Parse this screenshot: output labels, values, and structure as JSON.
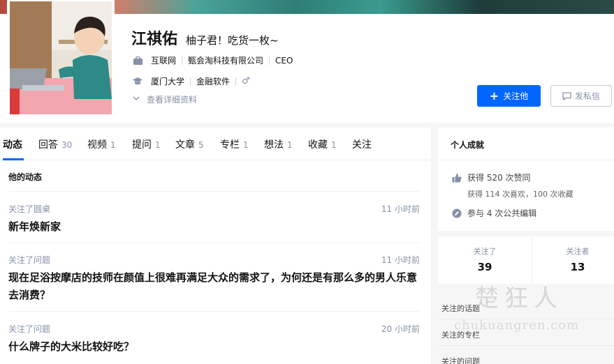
{
  "profile": {
    "name": "江祺佑",
    "headline": "柚子君！吃货一枚~",
    "industry": "互联网",
    "company": "甄会淘科技有限公司",
    "position": "CEO",
    "school": "厦门大学",
    "major": "金融软件",
    "gender_icon": "♂",
    "detail_link": "查看详细资料",
    "follow_button": "关注他",
    "message_button": "发私信"
  },
  "tabs": [
    {
      "label": "动态",
      "count": ""
    },
    {
      "label": "回答",
      "count": "30"
    },
    {
      "label": "视频",
      "count": "1"
    },
    {
      "label": "提问",
      "count": "1"
    },
    {
      "label": "文章",
      "count": "5"
    },
    {
      "label": "专栏",
      "count": "1"
    },
    {
      "label": "想法",
      "count": "1"
    },
    {
      "label": "收藏",
      "count": "1"
    },
    {
      "label": "关注",
      "count": ""
    }
  ],
  "feed": {
    "section_title": "他的动态",
    "items": [
      {
        "action": "关注了圆桌",
        "time": "11 小时前",
        "title": "新年焕新家"
      },
      {
        "action": "关注了问题",
        "time": "11 小时前",
        "title": "现在足浴按摩店的技师在颜值上很难再满足大众的需求了，为何还是有那么多的男人乐意去消费？"
      },
      {
        "action": "关注了问题",
        "time": "20 小时前",
        "title": "什么牌子的大米比较好吃？"
      }
    ]
  },
  "achievements": {
    "title": "个人成就",
    "likes": "获得 520 次赞同",
    "likes_sub": "获得 114 次喜欢，100 次收藏",
    "edits": "参与 4 次公共编辑"
  },
  "follow_stats": {
    "following_label": "关注了",
    "following_count": "39",
    "followers_label": "关注者",
    "followers_count": "13"
  },
  "side_links": [
    "关注的话题",
    "关注的专栏",
    "关注的问题"
  ],
  "watermark": {
    "cn": "楚狂人",
    "en": "chukuangren.com"
  },
  "colors": {
    "accent": "#0066ff",
    "muted": "#8590a6",
    "text": "#121212"
  }
}
